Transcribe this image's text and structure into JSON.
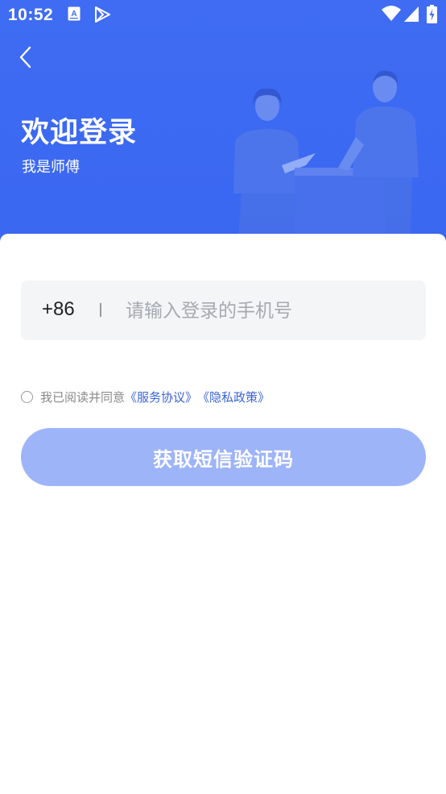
{
  "status_bar": {
    "time": "10:52",
    "icons": [
      "a-translate-icon",
      "play-store-icon",
      "wifi-icon",
      "signal-icon",
      "battery-charging-icon"
    ]
  },
  "header": {
    "back_icon": "chevron-left-icon",
    "title": "欢迎登录",
    "subtitle": "我是师傅",
    "background_color": "#3f6cf3"
  },
  "login_form": {
    "country_code": "+86",
    "phone_placeholder": "请输入登录的手机号",
    "phone_value": "",
    "agreement": {
      "checked": false,
      "prefix": "我已阅读并同意",
      "service_link": "《服务协议》",
      "privacy_link": "《隐私政策》",
      "link_color": "#3a64d8"
    },
    "submit_label": "获取短信验证码",
    "submit_color": "#9db4f8"
  }
}
